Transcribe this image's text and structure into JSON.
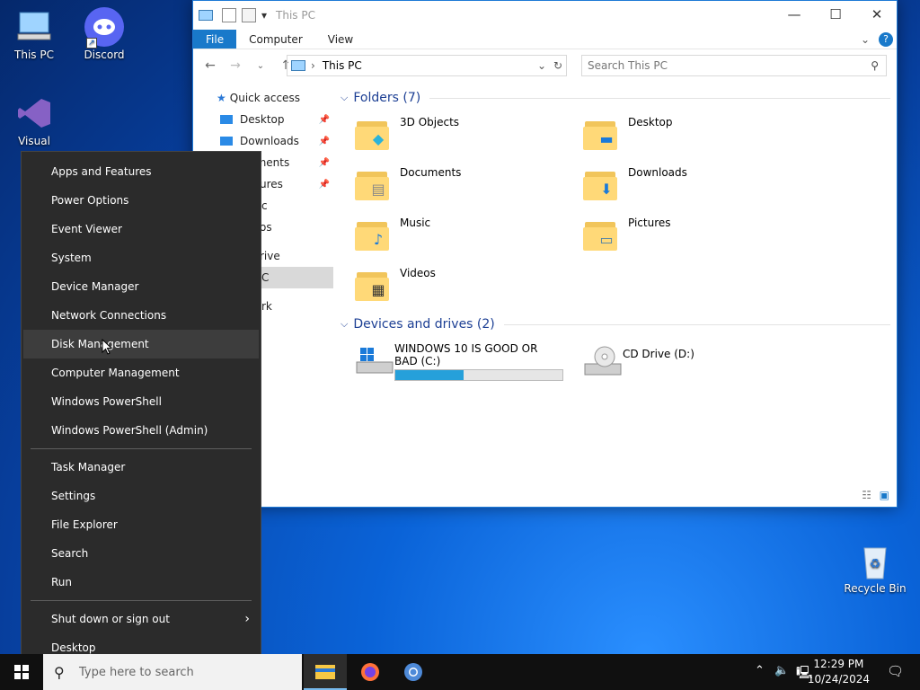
{
  "desktop": {
    "icons": [
      {
        "label": "This PC"
      },
      {
        "label": "Discord"
      },
      {
        "label": "Visual Studio"
      },
      {
        "label": "Recycle Bin"
      }
    ]
  },
  "explorer": {
    "title": "This PC",
    "ribbon_tabs": [
      "File",
      "Computer",
      "View"
    ],
    "address_path": "This PC",
    "search_placeholder": "Search This PC",
    "nav": {
      "quick_access": "Quick access",
      "items": [
        "Desktop",
        "Downloads",
        "uments",
        "ures",
        "c",
        "os",
        "rive",
        "C",
        "rk"
      ]
    },
    "folders_header": "Folders (7)",
    "folders": [
      "3D Objects",
      "Desktop",
      "Documents",
      "Downloads",
      "Music",
      "Pictures",
      "Videos"
    ],
    "drives_header": "Devices and drives (2)",
    "drives": [
      {
        "name": "WINDOWS 10 IS GOOD OR BAD (C:)",
        "used_fraction": 0.41
      },
      {
        "name": "CD Drive (D:)"
      }
    ]
  },
  "winx_menu": {
    "group1": [
      "Apps and Features",
      "Power Options",
      "Event Viewer",
      "System",
      "Device Manager",
      "Network Connections",
      "Disk Management",
      "Computer Management",
      "Windows PowerShell",
      "Windows PowerShell (Admin)"
    ],
    "group2": [
      "Task Manager",
      "Settings",
      "File Explorer",
      "Search",
      "Run"
    ],
    "group3": [
      "Shut down or sign out",
      "Desktop"
    ]
  },
  "taskbar": {
    "search_placeholder": "Type here to search",
    "time": "12:29 PM",
    "date": "10/24/2024"
  },
  "colors": {
    "accent": "#1979ca",
    "menu_bg": "#2b2b2b",
    "taskbar": "#101010"
  }
}
